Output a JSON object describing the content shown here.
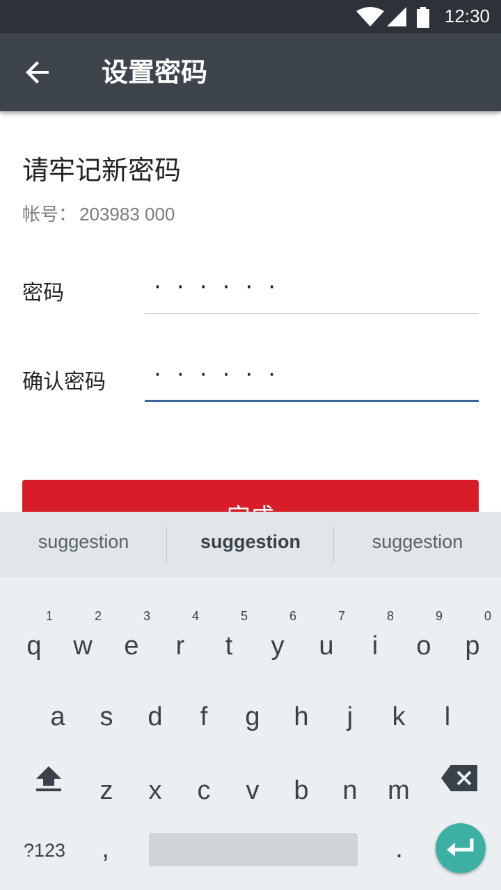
{
  "status_bar": {
    "time": "12:30",
    "icons": [
      "wifi-icon",
      "signal-icon",
      "battery-icon"
    ]
  },
  "app_bar": {
    "title": "设置密码",
    "back_icon": "arrow-left-icon"
  },
  "content": {
    "heading": "请牢记新密码",
    "account_label": "帐号：",
    "account_value": "203983 000",
    "password_label": "密码",
    "password_value": "······",
    "confirm_label": "确认密码",
    "confirm_value": "······",
    "done_button": "完成"
  },
  "keyboard": {
    "suggestions": [
      "suggestion",
      "suggestion",
      "suggestion"
    ],
    "row1": [
      {
        "k": "q",
        "h": "1"
      },
      {
        "k": "w",
        "h": "2"
      },
      {
        "k": "e",
        "h": "3"
      },
      {
        "k": "r",
        "h": "4"
      },
      {
        "k": "t",
        "h": "5"
      },
      {
        "k": "y",
        "h": "6"
      },
      {
        "k": "u",
        "h": "7"
      },
      {
        "k": "i",
        "h": "8"
      },
      {
        "k": "o",
        "h": "9"
      },
      {
        "k": "p",
        "h": "0"
      }
    ],
    "row2": [
      "a",
      "s",
      "d",
      "f",
      "g",
      "h",
      "j",
      "k",
      "l"
    ],
    "row3": [
      "z",
      "x",
      "c",
      "v",
      "b",
      "n",
      "m"
    ],
    "symbols_key": "?123",
    "comma_key": ",",
    "period_key": "."
  },
  "colors": {
    "app_bar": "#3e444c",
    "accent": "#3b6698",
    "button": "#d81c28",
    "enter": "#3bb0a3"
  }
}
